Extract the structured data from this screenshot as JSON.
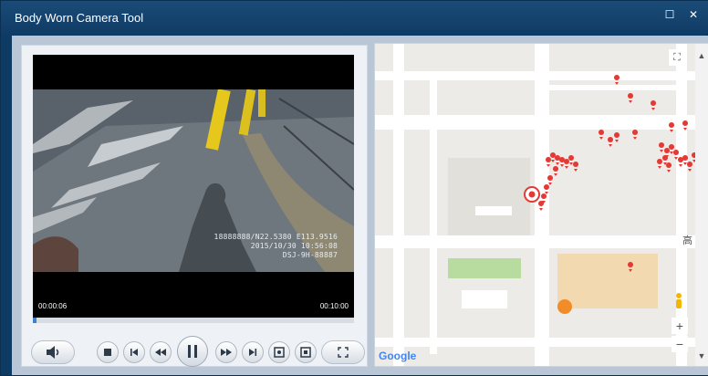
{
  "window": {
    "title": "Body Worn Camera Tool",
    "maximize_glyph": "☐",
    "close_glyph": "✕"
  },
  "player": {
    "overlay_line1": "18888888/N22.5380 E113.9516",
    "overlay_line2": "2015/10/30 10:56:08",
    "overlay_line3": "DSJ-9H-88887",
    "current_time": "00:00:06",
    "total_time": "00:10:00",
    "progress": 0.01
  },
  "controls": [
    {
      "name": "volume-button",
      "icon": "speaker-icon"
    },
    {
      "name": "stop-button",
      "icon": "stop-icon"
    },
    {
      "name": "previous-button",
      "icon": "skip-back-icon"
    },
    {
      "name": "rewind-button",
      "icon": "rewind-icon"
    },
    {
      "name": "pause-button",
      "icon": "pause-icon"
    },
    {
      "name": "fast-forward-button",
      "icon": "fast-forward-icon"
    },
    {
      "name": "next-button",
      "icon": "skip-forward-icon"
    },
    {
      "name": "snapshot-button",
      "icon": "snapshot-icon"
    },
    {
      "name": "record-clip-button",
      "icon": "clip-icon"
    },
    {
      "name": "fullscreen-button",
      "icon": "fullscreen-icon"
    }
  ],
  "map": {
    "chinese_label": "高",
    "zoom_in": "+",
    "zoom_out": "−",
    "logo": "Google",
    "accent_marker_color": "#e53935"
  }
}
